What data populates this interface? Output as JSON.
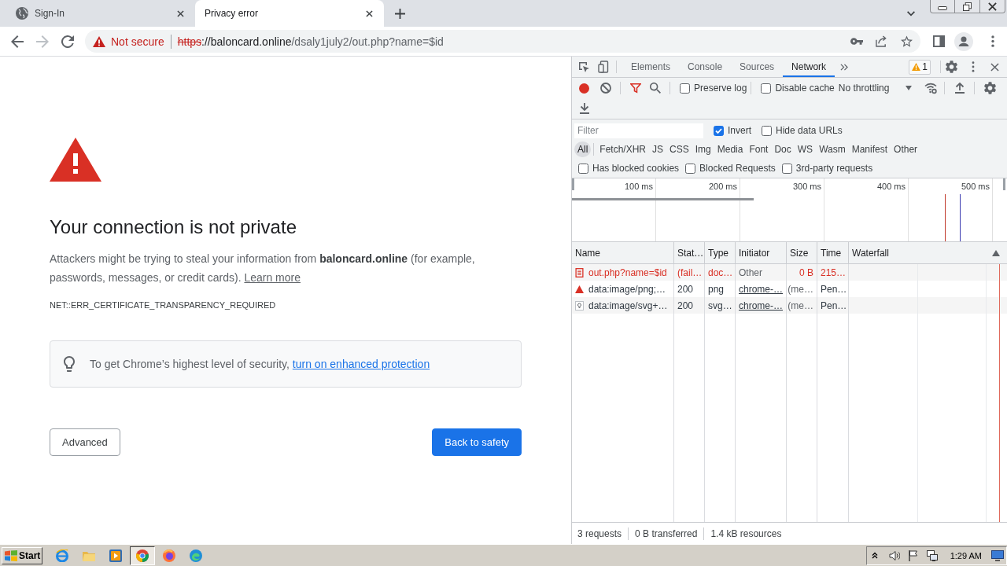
{
  "browser": {
    "tabs": [
      {
        "title": "Sign-In",
        "favicon": true,
        "selected": false
      },
      {
        "title": "Privacy error",
        "favicon": false,
        "selected": true
      }
    ],
    "nav": {
      "back_disabled": false,
      "forward_disabled": true
    },
    "address_bar": {
      "security": "Not secure",
      "scheme": "https",
      "host": "://baloncard.online",
      "path": "/dsaly1july2/out.php?name=$id"
    }
  },
  "page": {
    "heading": "Your connection is not private",
    "paragraph": "Attackers might be trying to steal your information from **baloncard.online** (for example, passwords, messages, or credit cards).",
    "learn_more": "Learn more",
    "error_code": "NET::ERR_CERTIFICATE_TRANSPARENCY_REQUIRED",
    "tip": {
      "text": "To get Chrome’s highest level of security,",
      "link": "turn on enhanced protection"
    },
    "buttons": [
      {
        "label": "Advanced",
        "kind": "secondary"
      },
      {
        "label": "Back to safety",
        "kind": "primary"
      }
    ]
  },
  "devtools": {
    "tabs": [
      {
        "label": "Elements",
        "selected": false
      },
      {
        "label": "Console",
        "selected": false
      },
      {
        "label": "Sources",
        "selected": false
      },
      {
        "label": "Network",
        "selected": true
      }
    ],
    "issues_count": "1",
    "toolbar": {
      "recording": true,
      "filter_open": true,
      "checkboxes": [
        {
          "label": "Preserve log",
          "checked": false
        },
        {
          "label": "Disable cache",
          "checked": false
        }
      ],
      "throttling": "No throttling"
    },
    "filter": {
      "placeholder": "Filter",
      "checkboxes": [
        {
          "label": "Invert",
          "checked": true
        },
        {
          "label": "Hide data URLs",
          "checked": false
        }
      ]
    },
    "type_filters": [
      {
        "label": "All",
        "selected": true
      },
      {
        "label": "Fetch/XHR",
        "selected": false
      },
      {
        "label": "JS",
        "selected": false
      },
      {
        "label": "CSS",
        "selected": false
      },
      {
        "label": "Img",
        "selected": false
      },
      {
        "label": "Media",
        "selected": false
      },
      {
        "label": "Font",
        "selected": false
      },
      {
        "label": "Doc",
        "selected": false
      },
      {
        "label": "WS",
        "selected": false
      },
      {
        "label": "Wasm",
        "selected": false
      },
      {
        "label": "Manifest",
        "selected": false
      },
      {
        "label": "Other",
        "selected": false
      }
    ],
    "request_filters": [
      {
        "label": "Has blocked cookies",
        "checked": false
      },
      {
        "label": "Blocked Requests",
        "checked": false
      },
      {
        "label": "3rd-party requests",
        "checked": false
      }
    ],
    "overview": {
      "ticks": [
        "100 ms",
        "200 ms",
        "300 ms",
        "400 ms",
        "500 ms"
      ]
    },
    "table": {
      "columns": [
        {
          "label": "Name"
        },
        {
          "label": "Stat…"
        },
        {
          "label": "Type"
        },
        {
          "label": "Initiator"
        },
        {
          "label": "Size"
        },
        {
          "label": "Time"
        },
        {
          "label": "Waterfall",
          "sort_ascending": true
        }
      ],
      "rows": [
        {
          "kind": "document",
          "name": "out.php?name=$id",
          "status": "(fail…",
          "type": "doc…",
          "initiator": "Other",
          "initiator_link": false,
          "size": "0 B",
          "time": "215…",
          "failed": true
        },
        {
          "kind": "raster",
          "name": "data:image/png;…",
          "status": "200",
          "type": "png",
          "initiator": "chrome-…",
          "initiator_link": true,
          "size": "(me…",
          "time": "Pen…",
          "failed": false
        },
        {
          "kind": "vector",
          "name": "data:image/svg+…",
          "status": "200",
          "type": "svg…",
          "initiator": "chrome-…",
          "initiator_link": true,
          "size": "(me…",
          "time": "Pen…",
          "failed": false
        }
      ]
    },
    "status_bar": [
      "3 requests",
      "0 B transferred",
      "1.4 kB resources"
    ]
  },
  "taskbar": {
    "start": "Start",
    "apps": [
      {
        "selected": false
      },
      {
        "selected": false
      },
      {
        "selected": false
      },
      {
        "selected": true
      },
      {
        "selected": false
      },
      {
        "selected": false
      }
    ],
    "clock": "1:29 AM"
  }
}
